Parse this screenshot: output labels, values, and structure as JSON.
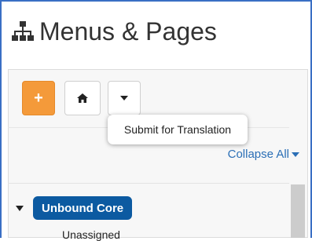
{
  "header": {
    "title": "Menus & Pages",
    "icon": "sitemap-icon"
  },
  "toolbar": {
    "add_label": "+",
    "home_icon": "home-icon",
    "dropdown_icon": "caret-down-icon"
  },
  "tooltip": {
    "text": "Submit for Translation"
  },
  "tree": {
    "collapse_all_label": "Collapse All",
    "root_menu_label": "Unbound Core",
    "child_label": "Unassigned"
  },
  "colors": {
    "accent_orange": "#f49a3a",
    "badge_blue": "#0c5aa1",
    "link_blue": "#2b6fb6"
  }
}
